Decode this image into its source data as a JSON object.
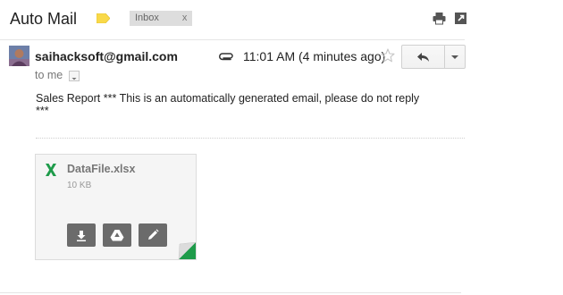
{
  "header": {
    "subject": "Auto Mail",
    "label_chip": "Inbox",
    "label_chip_remove": "x",
    "label_color": "#f9d949",
    "print_icon": "print-icon",
    "popout_icon": "new-window-icon"
  },
  "message": {
    "sender_email": "saihacksoft@gmail.com",
    "recipient_label": "to me",
    "timestamp": "11:01 AM (4 minutes ago)",
    "attachment_icon": "paperclip-icon",
    "star_icon": "star-outline-icon",
    "reply_icon": "reply-icon",
    "more_icon": "chevron-down-icon",
    "body_line1": "Sales Report *** This is an automatically generated email, please do not reply",
    "body_line2": "***"
  },
  "attachment": {
    "file_name": "DataFile.xlsx",
    "file_size": "10 KB",
    "type_icon": "excel-icon",
    "type_color": "#1e9b4a",
    "actions": [
      "download-icon",
      "drive-icon",
      "edit-icon"
    ]
  }
}
